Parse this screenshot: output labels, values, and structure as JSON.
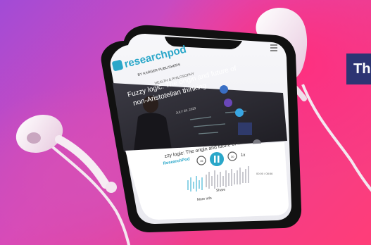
{
  "photo": {
    "subject": "smartphone-with-earbuds",
    "colors": {
      "background_left": "#a24bd6",
      "background_right": "#ff3d78",
      "phone_body": "#111111",
      "screen_bg": "#f4f4f6",
      "accent": "#2aa7c9"
    }
  },
  "app": {
    "logo_text": "researchpod",
    "logo_tagline": "BY KARGER PUBLISHERS",
    "breadcrumb": "HEALTH & PHILOSOPHY",
    "episode_title_line1": "Fuzzy logic: The origin and future of",
    "episode_title_line2": "non-Aristotelian thinking",
    "date": "JULY 26, 2023",
    "player_title": "zzy logic: The origin and future of n...",
    "player_source": "ResearchPod",
    "skip_back": "15",
    "skip_forward": "30",
    "speed": "1x",
    "time": "00:00 / 08:56",
    "more_info": "More info",
    "share": "Share"
  },
  "banner": {
    "text": "Th"
  }
}
